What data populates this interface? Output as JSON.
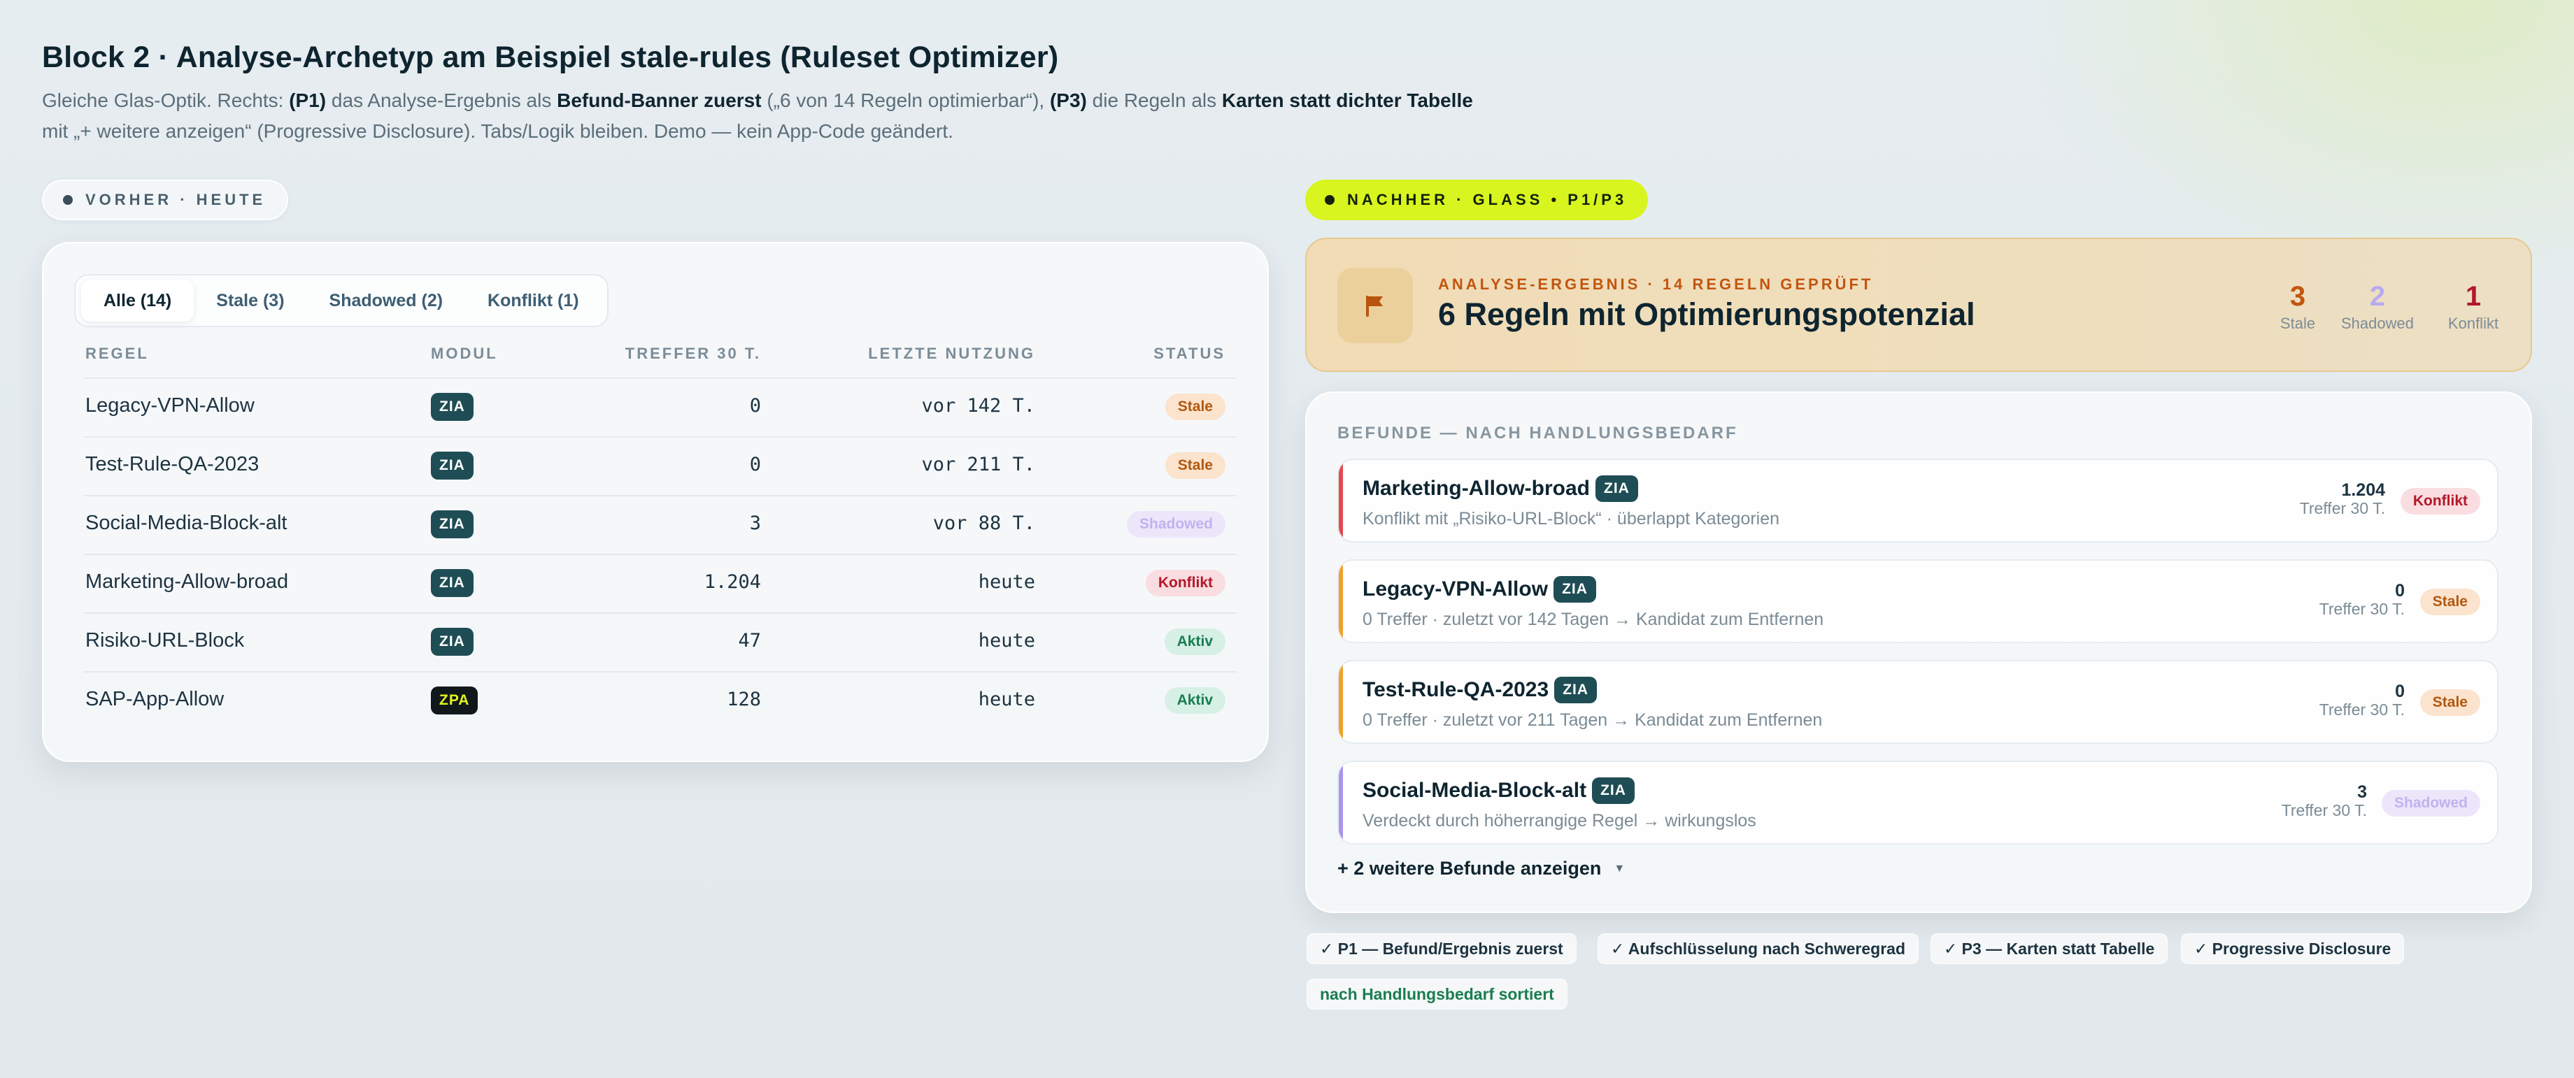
{
  "header": {
    "title": "Block 2 · Analyse-Archetyp am Beispiel stale-rules (Ruleset Optimizer)",
    "subtitle_parts": [
      "Gleiche Glas-Optik. Rechts: ",
      "(P1)",
      " das Analyse-Ergebnis als ",
      "Befund-Banner zuerst",
      " („6 von 14 Regeln optimierbar“), ",
      "(P3)",
      " die Regeln als ",
      "Karten statt dichter Tabelle",
      " mit „+ weitere anzeigen“ (Progressive Disclosure). Tabs/Logik bleiben. Demo — kein App-Code geändert."
    ]
  },
  "before": {
    "pill": "VORHER · HEUTE",
    "tabs": [
      "Alle (14)",
      "Stale (3)",
      "Shadowed (2)",
      "Konflikt (1)"
    ],
    "columns": [
      "REGEL",
      "MODUL",
      "TREFFER 30 T.",
      "LETZTE NUTZUNG",
      "STATUS"
    ],
    "rows": [
      {
        "name": "Legacy-VPN-Allow",
        "module": "ZIA",
        "hits": "0",
        "last": "vor 142 T.",
        "status": "Stale"
      },
      {
        "name": "Test-Rule-QA-2023",
        "module": "ZIA",
        "hits": "0",
        "last": "vor 211 T.",
        "status": "Stale"
      },
      {
        "name": "Social-Media-Block-alt",
        "module": "ZIA",
        "hits": "3",
        "last": "vor 88 T.",
        "status": "Shadowed"
      },
      {
        "name": "Marketing-Allow-broad",
        "module": "ZIA",
        "hits": "1.204",
        "last": "heute",
        "status": "Konflikt"
      },
      {
        "name": "Risiko-URL-Block",
        "module": "ZIA",
        "hits": "47",
        "last": "heute",
        "status": "Aktiv"
      },
      {
        "name": "SAP-App-Allow",
        "module": "ZPA",
        "hits": "128",
        "last": "heute",
        "status": "Aktiv"
      }
    ]
  },
  "after": {
    "pill": "NACHHER · GLASS • P1/P3",
    "banner": {
      "icon": "flag-icon",
      "kicker": "ANALYSE-ERGEBNIS · 14 REGELN GEPRÜFT",
      "title": "6 Regeln mit Optimierungspotenzial",
      "stats": [
        {
          "value": "3",
          "label": "Stale",
          "color": "#c2560f"
        },
        {
          "value": "2",
          "label": "Shadowed",
          "color": "#b7aaf0"
        },
        {
          "value": "1",
          "label": "Konflikt",
          "color": "#b4172a"
        }
      ]
    },
    "findings_title": "BEFUNDE — NACH HANDLUNGSBEDARF",
    "findings": [
      {
        "name": "Marketing-Allow-broad",
        "module": "ZIA",
        "desc": "Konflikt mit „Risiko-URL-Block“ · überlappt Kategorien",
        "hits": "1.204",
        "hits_label": "Treffer 30 T.",
        "status": "Konflikt",
        "accent": "#e3484f"
      },
      {
        "name": "Legacy-VPN-Allow",
        "module": "ZIA",
        "desc": "0 Treffer · zuletzt vor 142 Tagen → Kandidat zum Entfernen",
        "hits": "0",
        "hits_label": "Treffer 30 T.",
        "status": "Stale",
        "accent": "#f0a12a"
      },
      {
        "name": "Test-Rule-QA-2023",
        "module": "ZIA",
        "desc": "0 Treffer · zuletzt vor 211 Tagen → Kandidat zum Entfernen",
        "hits": "0",
        "hits_label": "Treffer 30 T.",
        "status": "Stale",
        "accent": "#f0a12a"
      },
      {
        "name": "Social-Media-Block-alt",
        "module": "ZIA",
        "desc": "Verdeckt durch höherrangige Regel → wirkungslos",
        "hits": "3",
        "hits_label": "Treffer 30 T.",
        "status": "Shadowed",
        "accent": "#a995ec"
      }
    ],
    "more": "+ 2 weitere Befunde anzeigen",
    "tags": [
      "✓ P1 — Befund/Ergebnis zuerst",
      "✓ Aufschlüsselung nach Schweregrad",
      "✓ P3 — Karten statt Tabelle",
      "✓ Progressive Disclosure"
    ],
    "tag_sorted": "nach Handlungsbedarf sortiert"
  }
}
